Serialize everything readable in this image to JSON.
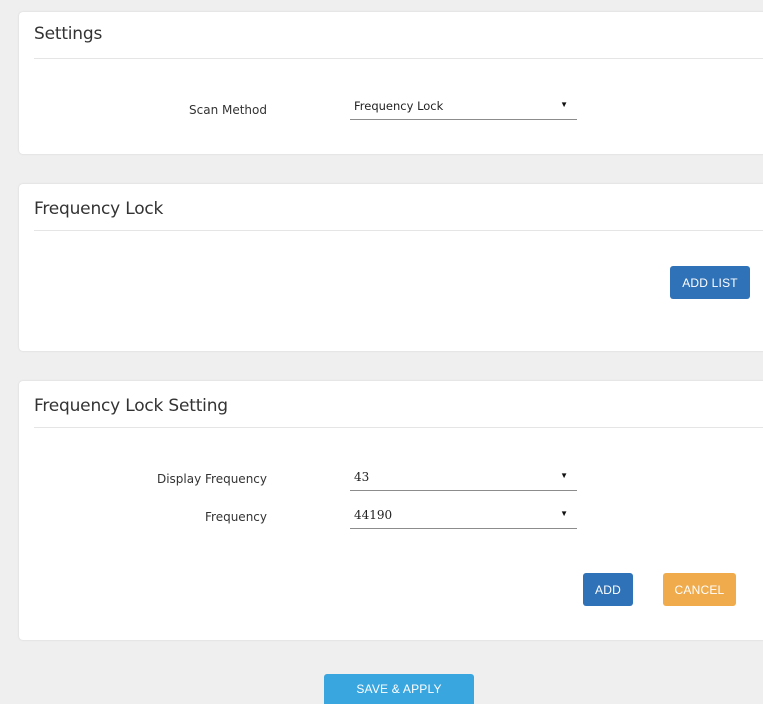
{
  "settings_panel": {
    "title": "Settings",
    "scan_method": {
      "label": "Scan Method",
      "value": "Frequency Lock"
    }
  },
  "frequency_lock_panel": {
    "title": "Frequency Lock",
    "add_list_label": "ADD LIST"
  },
  "frequency_lock_setting_panel": {
    "title": "Frequency Lock Setting",
    "display_frequency": {
      "label": "Display Frequency",
      "value": "43"
    },
    "frequency": {
      "label": "Frequency",
      "value": "44190"
    },
    "add_label": "ADD",
    "cancel_label": "CANCEL"
  },
  "footer": {
    "save_apply_label": "SAVE & APPLY"
  },
  "icons": {
    "dropdown": "triangle-down-icon"
  },
  "colors": {
    "primary_button": "#2f72b8",
    "cancel_button": "#efab4c",
    "save_button": "#3aa6e0",
    "page_background": "#efefef"
  }
}
